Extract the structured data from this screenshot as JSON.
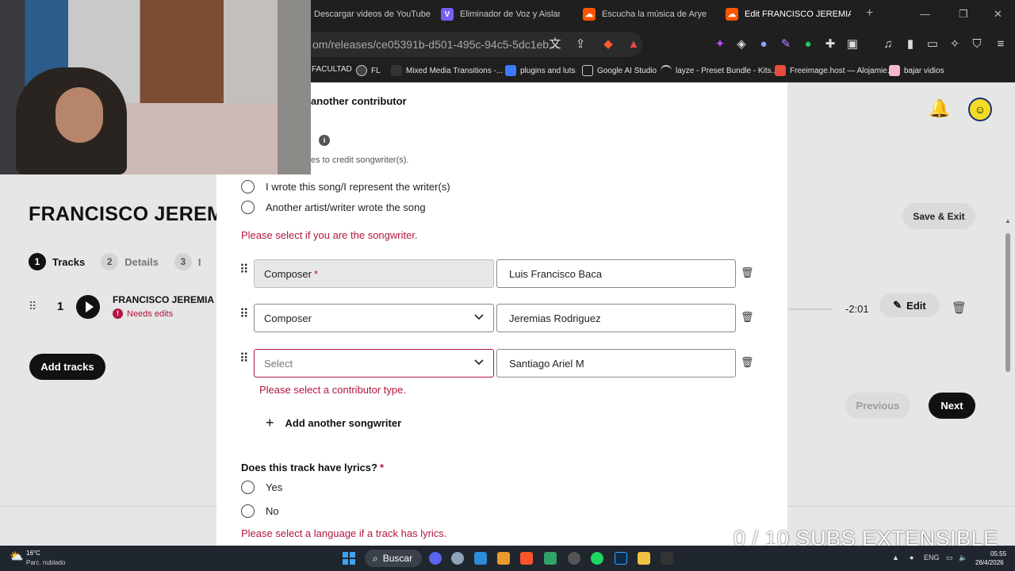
{
  "browser": {
    "tabs": [
      {
        "label": "Descargar videos de YouTube grati",
        "favicon": "V",
        "color": "#1f1f1f"
      },
      {
        "label": "Eliminador de Voz y Aislamiento [A",
        "favicon": "V",
        "color": "#7b5cf5"
      },
      {
        "label": "Escucha la música de Aryes | Disfru",
        "favicon": "soundcloud-icon",
        "color": "#ff5500"
      },
      {
        "label": "Edit FRANCISCO JEREMIAS (p",
        "favicon": "soundcloud-icon",
        "color": "#ff5500"
      }
    ],
    "url_main": "om/releases/ce05391b-d501-495c-94c5-5dc1eb...",
    "bookmarks": [
      "FACULTAD",
      "FL",
      "Mixed Media Transitions -...",
      "plugins and luts",
      "Google AI Studio",
      "layze - Preset Bundle - Kits...",
      "Freeimage.host — Alojamie...",
      "bajar vidios"
    ]
  },
  "page": {
    "release_title": "FRANCISCO JEREM",
    "steps": [
      {
        "num": "1",
        "label": "Tracks"
      },
      {
        "num": "2",
        "label": "Details"
      },
      {
        "num": "3",
        "label": "I"
      }
    ],
    "track": {
      "number": "1",
      "title": "FRANCISCO JEREMIA",
      "warning": "Needs edits",
      "duration": "-2:01",
      "edit_label": "Edit"
    },
    "add_tracks_label": "Add tracks",
    "save_exit_label": "Save & Exit",
    "previous_label": "Previous",
    "next_label": "Next"
  },
  "modal": {
    "add_contributor_heading": "another contributor",
    "songwriter_hint": "es to credit songwriter(s).",
    "songwriter_options": [
      "I wrote this song/I represent the writer(s)",
      "Another artist/writer wrote the song"
    ],
    "songwriter_error": "Please select if you are the songwriter.",
    "contributors": [
      {
        "role": "Composer",
        "required": "*",
        "name": "Luis Francisco Baca"
      },
      {
        "role": "Composer",
        "name": "Jeremias Rodriguez"
      },
      {
        "role": "Select",
        "name": "Santiago Ariel M"
      }
    ],
    "contributor_error": "Please select a contributor type.",
    "add_songwriter_label": "Add another songwriter",
    "lyrics_question": "Does this track have lyrics?",
    "lyrics_required": "*",
    "lyrics_options": [
      "Yes",
      "No"
    ],
    "lyrics_error": "Please select a language if a track has lyrics."
  },
  "overlay": {
    "watermark": "0 / 10 SUBS EXTENSIBLE"
  },
  "taskbar": {
    "temperature": "16°C",
    "weather": "Parc. nublado",
    "search_label": "Buscar",
    "language": "ENG",
    "time": "05:55",
    "date": "26/4/2026"
  },
  "colors": {
    "error": "#b3173f",
    "primary_button": "#111111",
    "soundcloud": "#ff5500"
  }
}
